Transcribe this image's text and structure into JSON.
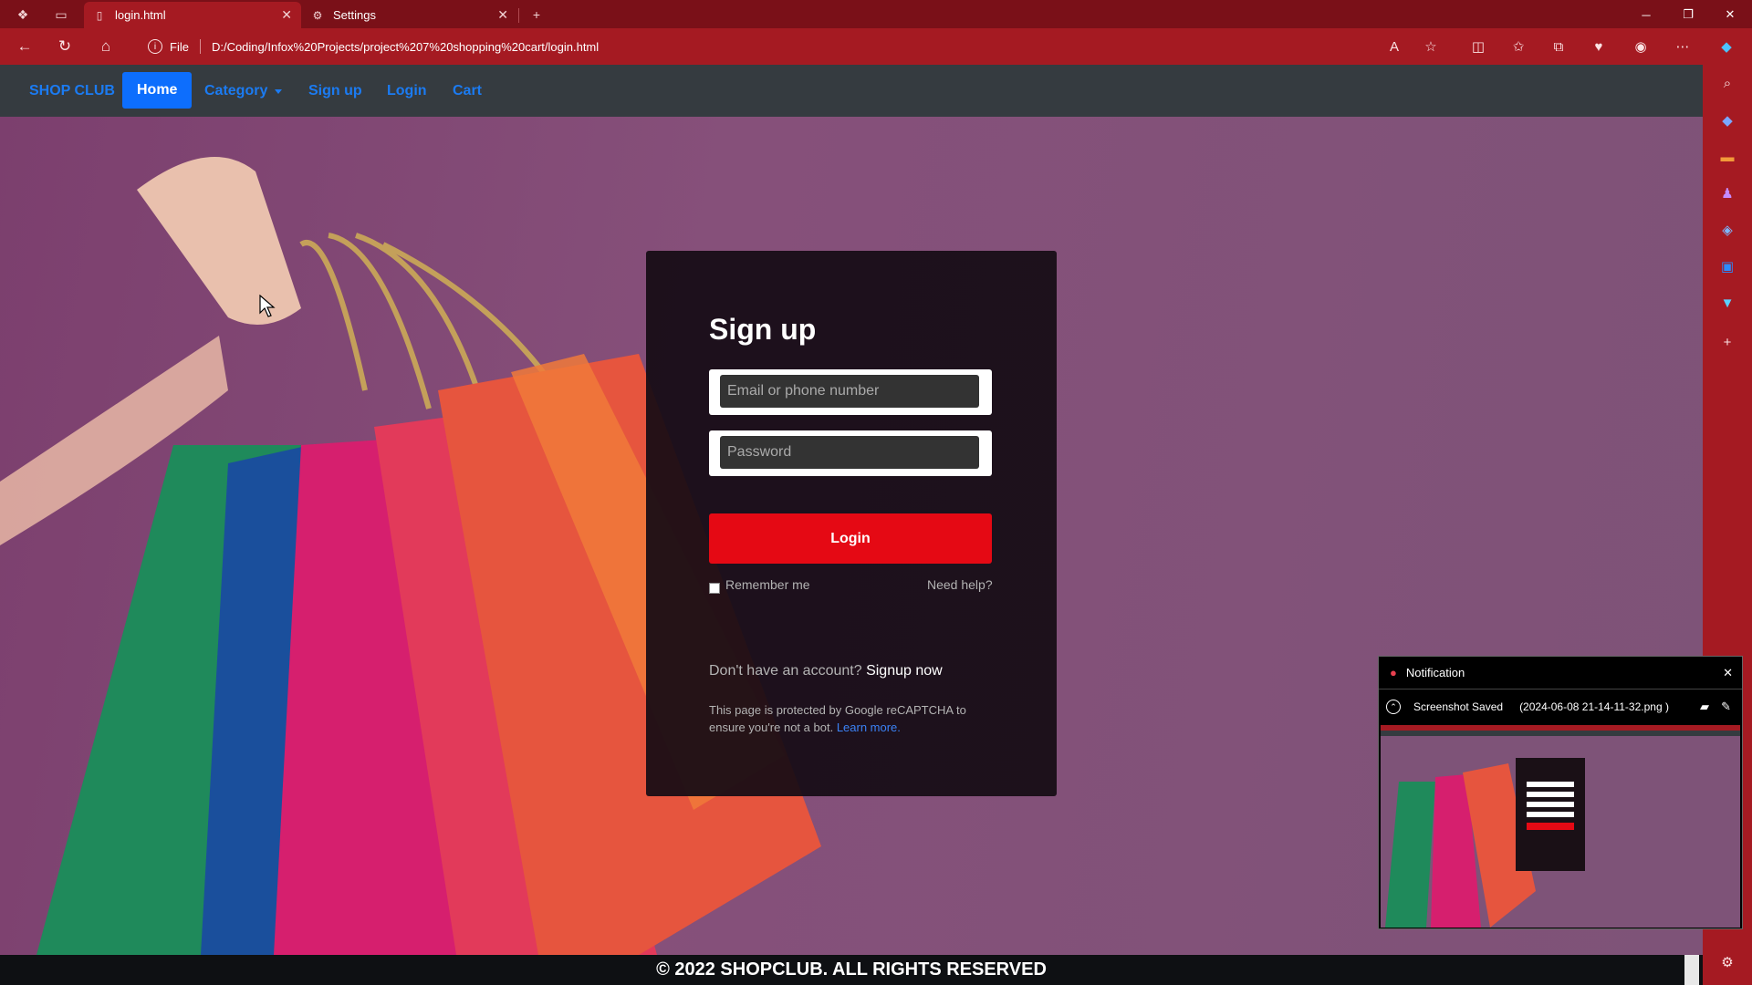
{
  "browser": {
    "tabs": [
      {
        "title": "login.html",
        "icon": "file-icon"
      },
      {
        "title": "Settings",
        "icon": "gear-icon"
      }
    ],
    "address": {
      "info_label": "File",
      "url": "D:/Coding/Infox%20Projects/project%207%20shopping%20cart/login.html"
    }
  },
  "site": {
    "brand": "SHOP CLUB",
    "nav": [
      "Home",
      "Category",
      "Sign up",
      "Login",
      "Cart"
    ],
    "footer": "© 2022 SHOPCLUB. ALL RIGHTS RESERVED"
  },
  "form": {
    "title": "Sign up",
    "email_placeholder": "Email or phone number",
    "password_placeholder": "Password",
    "login_button": "Login",
    "remember_label": "Remember me",
    "need_help": "Need help?",
    "no_account": "Don't have an account?",
    "signup_now": "Signup now",
    "captcha_text": "This page is protected by Google reCAPTCHA to ensure you're not a bot.",
    "learn_more": "Learn more."
  },
  "notification": {
    "title": "Notification",
    "status": "Screenshot Saved",
    "filename": "(2024-06-08 21-14-11-32.png )"
  },
  "colors": {
    "browser_frame": "#a51a22",
    "navbar": "#353b40",
    "nav_link": "#1b7bf2",
    "nav_active": "#0d6efd",
    "login_button": "#e50914",
    "card": "#160c14"
  }
}
